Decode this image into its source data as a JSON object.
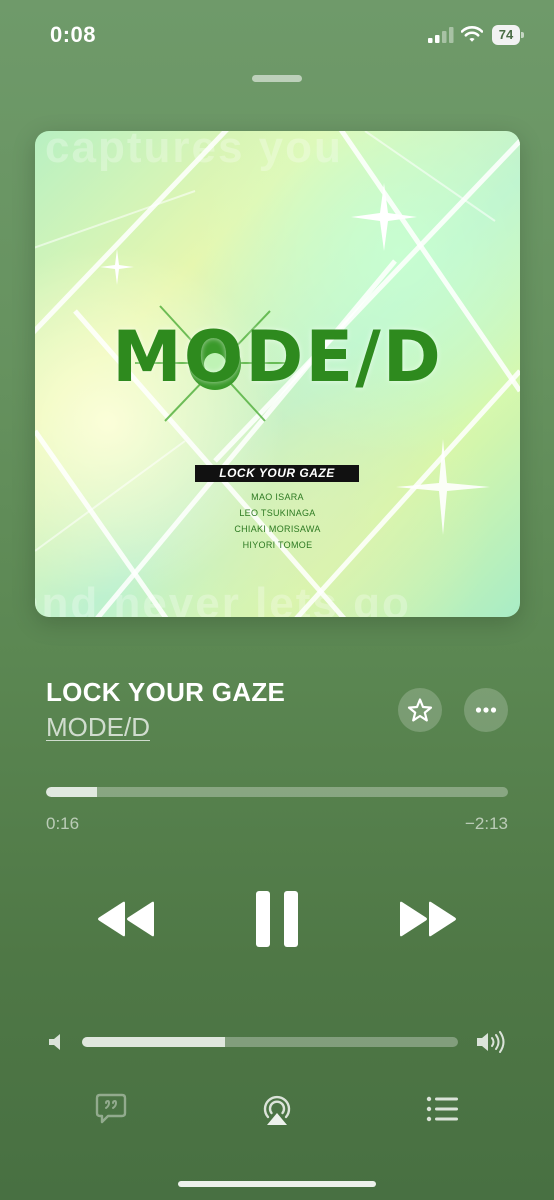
{
  "status_bar": {
    "time": "0:08",
    "battery_level": "74",
    "icons": [
      "signal-icon",
      "wifi-icon",
      "battery-icon"
    ]
  },
  "album_art": {
    "logo": "MODE/D",
    "title_bar": "LOCK YOUR GAZE",
    "members": [
      "MAO ISARA",
      "LEO TSUKINAGA",
      "CHIAKI MORISAWA",
      "HIYORI TOMOE"
    ],
    "watermark_top": "captures you",
    "watermark_bottom": "and never lets go"
  },
  "track": {
    "title": "LOCK YOUR GAZE",
    "artist": "MODE/D"
  },
  "actions": {
    "favorite_icon": "star-icon",
    "more_icon": "ellipsis-icon"
  },
  "progress": {
    "elapsed": "0:16",
    "remaining": "−2:13",
    "fraction": 0.11
  },
  "transport": {
    "icons": [
      "rewind-icon",
      "pause-icon",
      "fast-forward-icon"
    ]
  },
  "volume": {
    "level": 0.38,
    "icons": [
      "volume-low-icon",
      "volume-high-icon"
    ]
  },
  "bottom_bar": {
    "icons": [
      "lyrics-icon",
      "airplay-icon",
      "queue-icon"
    ]
  },
  "colors": {
    "background": "#5f8b57",
    "logo_green": "#2e8a1e"
  }
}
